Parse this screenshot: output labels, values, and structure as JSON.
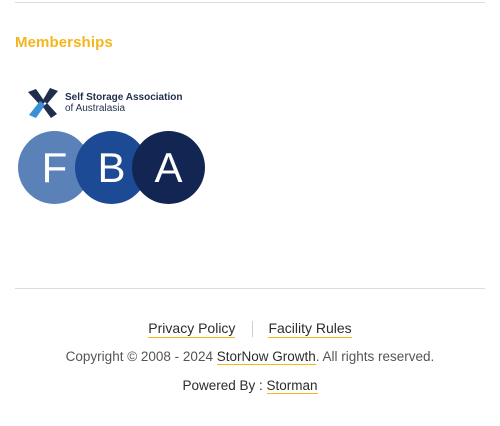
{
  "memberships": {
    "heading": "Memberships",
    "ssaa": {
      "line1": "Self Storage Association",
      "line2": "of Australasia"
    },
    "fba": {
      "letters": [
        "F",
        "B",
        "A"
      ]
    }
  },
  "footer": {
    "links": {
      "privacy": "Privacy Policy",
      "facility": "Facility Rules"
    },
    "copyright": {
      "prefix": "Copyright © 2008 - 2024",
      "company": "StorNow Growth",
      "suffix": ". All rights reserved."
    },
    "powered": {
      "prefix": "Powered By :",
      "brand": "Storman"
    }
  },
  "colors": {
    "accent": "#f5b51c",
    "fba_f": "#5a82b8",
    "fba_b": "#1d4a95",
    "fba_a": "#132553",
    "ssaa_navy": "#1f2e4c",
    "ssaa_blue": "#3a8fd6"
  }
}
